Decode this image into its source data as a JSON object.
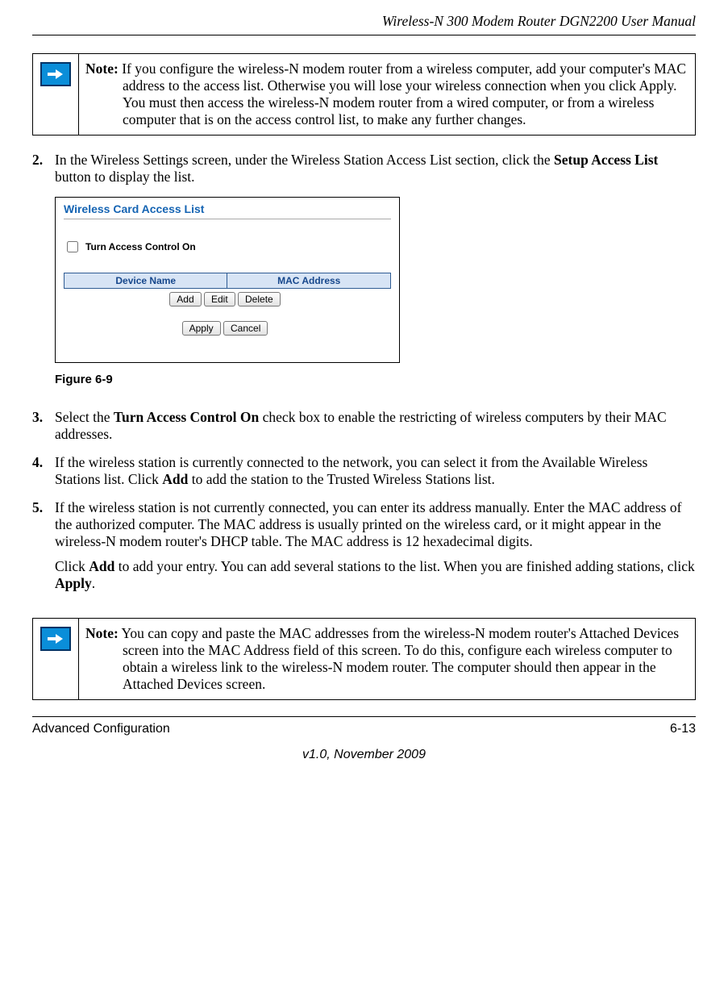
{
  "header": {
    "title": "Wireless-N 300 Modem Router DGN2200 User Manual"
  },
  "note1": {
    "label": "Note:",
    "text": "If you configure the wireless-N modem router from a wireless computer, add your computer's MAC address to the access list. Otherwise you will lose your wireless connection when you click Apply. You must then access the wireless-N modem router from a wired computer, or from a wireless computer that is on the access control list, to make any further changes."
  },
  "steps": {
    "s2": {
      "num": "2.",
      "t1": "In the Wireless Settings screen, under the Wireless Station Access List section, click the ",
      "b1": "Setup Access List",
      "t2": " button to display the list."
    },
    "s3": {
      "num": "3.",
      "t1": "Select the ",
      "b1": "Turn Access Control On",
      "t2": " check box to enable the restricting of wireless computers by their MAC addresses."
    },
    "s4": {
      "num": "4.",
      "t1": "If the wireless station is currently connected to the network, you can select it from the Available Wireless Stations list. Click ",
      "b1": "Add",
      "t2": " to add the station to the Trusted Wireless Stations list."
    },
    "s5": {
      "num": "5.",
      "t1": "If the wireless station is not currently connected, you can enter its address manually. Enter the MAC address of the authorized computer. The MAC address is usually printed on the wireless card, or it might appear in the wireless-N modem router's DHCP table. The MAC address is 12 hexadecimal digits.",
      "p2a": "Click ",
      "p2b1": "Add",
      "p2b": " to add your entry. You can add several stations to the list. When you are finished adding stations, click ",
      "p2b2": "Apply",
      "p2c": "."
    }
  },
  "figure": {
    "title": "Wireless Card Access List",
    "checkbox": "Turn Access Control On",
    "col1": "Device Name",
    "col2": "MAC Address",
    "btn_add": "Add",
    "btn_edit": "Edit",
    "btn_delete": "Delete",
    "btn_apply": "Apply",
    "btn_cancel": "Cancel",
    "caption": "Figure 6-9"
  },
  "note2": {
    "label": "Note:",
    "text": "You can copy and paste the MAC addresses from the wireless-N modem router's Attached Devices screen into the MAC Address field of this screen. To do this, configure each wireless computer to obtain a wireless link to the wireless-N modem router. The computer should then appear in the Attached Devices screen."
  },
  "footer": {
    "left": "Advanced Configuration",
    "right": "6-13",
    "center": "v1.0, November 2009"
  }
}
